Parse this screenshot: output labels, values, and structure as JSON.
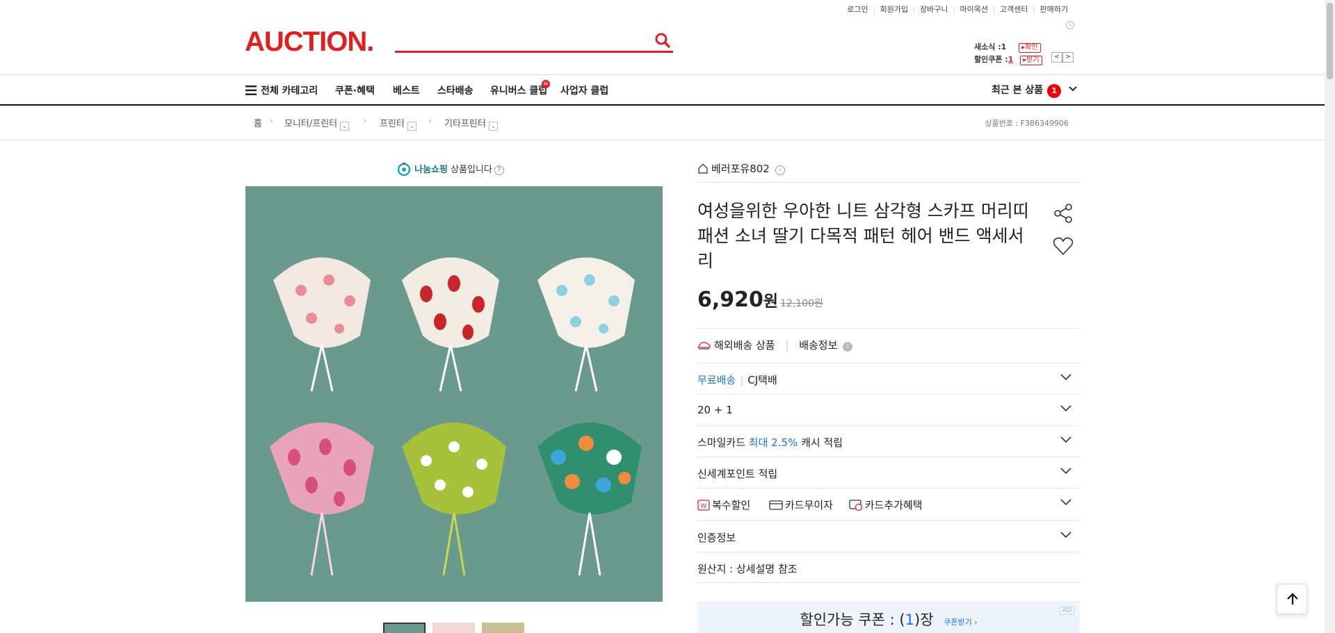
{
  "header": {
    "top_links": [
      "로그인",
      "회원가입",
      "장바구니",
      "마이옥션",
      "고객센터",
      "판매하기"
    ],
    "logo": "AUCTION.",
    "search": {
      "value": "",
      "placeholder": ""
    },
    "news": {
      "label": "새소식 :",
      "count": "1",
      "button": "확인"
    },
    "coupon": {
      "label": "할인쿠폰 :",
      "count": "1",
      "button": "받기"
    }
  },
  "gnb": {
    "all_category": "전체 카테고리",
    "items": [
      "쿠폰·혜택",
      "베스트",
      "스타배송",
      "유니버스 클럽",
      "사업자 클럽"
    ],
    "recent_label": "최근 본 상품",
    "recent_count": "1"
  },
  "breadcrumb": {
    "home": "홈",
    "levels": [
      "모니터/프린터",
      "프린터",
      "기타프린터"
    ],
    "product_no": "상품번호 : F386349906"
  },
  "product": {
    "nanum_brand": "나눔쇼핑",
    "nanum_text": "상품입니다",
    "seller": "베러포유802",
    "title": "여성을위한 우아한 니트 삼각형 스카프 머리띠 패션 소녀 딸기 다목적 패턴 헤어 밴드 액세서리",
    "price": "6,920",
    "price_unit": "원",
    "original_price": "12,100원"
  },
  "info_rows": {
    "overseas": "해외배송 상품",
    "shipping_info": "배송정보",
    "free_shipping": "무료배송",
    "courier": "CJ택배",
    "bundle": "20 + 1",
    "smilecard_prefix": "스마일카드",
    "smilecard_highlight": "최대 2.5%",
    "smilecard_suffix": "캐시 적립",
    "shinsegae": "신세계포인트 적립",
    "multi_discount": "복수할인",
    "card_interest": "카드무이자",
    "card_extra": "카드추가혜택",
    "certification": "인증정보",
    "origin": "원산지 : 상세설명 참조"
  },
  "coupon_banner": {
    "prefix": "할인가능 쿠폰 : (",
    "count": "1",
    "suffix": ")장",
    "link": "쿠폰받기",
    "ad": "AD"
  },
  "colors": {
    "brand": "#e02020",
    "link_blue": "#1a73e8",
    "image_bg": "#6a9a8e"
  },
  "icons": [
    "search-icon",
    "hamburger-icon",
    "chevron-down-icon",
    "share-icon",
    "heart-icon",
    "home-icon",
    "truck-icon",
    "info-icon",
    "arrow-up-icon"
  ]
}
